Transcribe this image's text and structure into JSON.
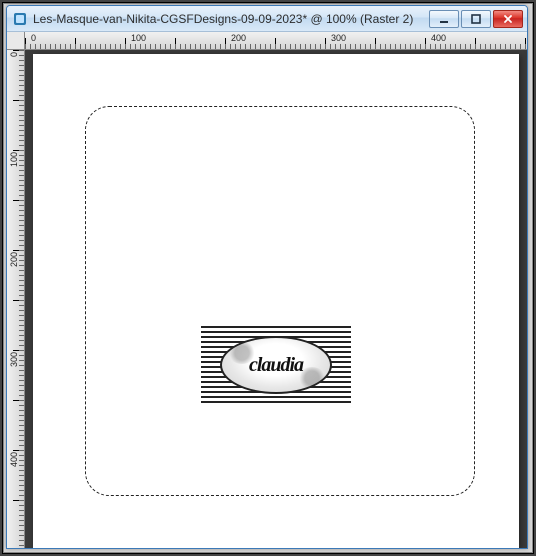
{
  "window": {
    "title": "Les-Masque-van-Nikita-CGSFDesigns-09-09-2023* @ 100% (Raster 2)"
  },
  "ruler": {
    "h": [
      "0",
      "100",
      "200",
      "300",
      "400"
    ],
    "v": [
      "0",
      "100",
      "200",
      "300",
      "400"
    ]
  },
  "watermark": {
    "name": "claudia"
  }
}
